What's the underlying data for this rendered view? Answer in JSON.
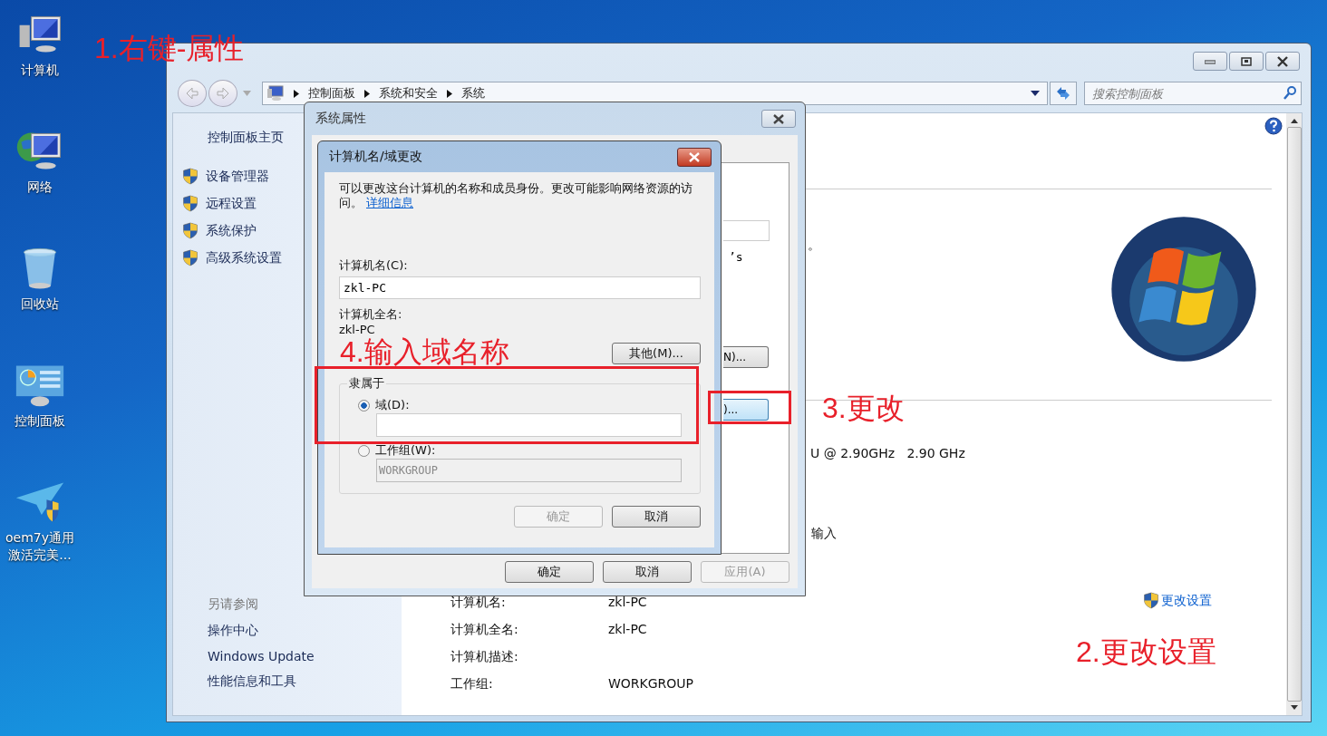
{
  "desktop_icons": [
    {
      "kind": "computer",
      "label": "计算机"
    },
    {
      "kind": "network",
      "label": "网络"
    },
    {
      "kind": "recycle",
      "label": "回收站"
    },
    {
      "kind": "control_panel",
      "label": "控制面板"
    },
    {
      "kind": "shield_plane",
      "label": "oem7y通用激活完美..."
    }
  ],
  "explorer": {
    "breadcrumb": [
      "控制面板",
      "系统和安全",
      "系统"
    ],
    "search": {
      "placeholder": "搜索控制面板"
    },
    "sidebar": {
      "home": "控制面板主页",
      "tasks": [
        "设备管理器",
        "远程设置",
        "系统保护",
        "高级系统设置"
      ],
      "see_also_title": "另请参阅",
      "see_also": [
        "操作中心",
        "Windows Update",
        "性能信息和工具"
      ]
    },
    "content": {
      "fragment_period": "。",
      "fragment_cpu": "U @ 2.90GHz   2.90 GHz",
      "fragment_input": "输入",
      "info_rows": [
        {
          "label": "计算机名:",
          "value": "zkl-PC"
        },
        {
          "label": "计算机全名:",
          "value": "zkl-PC"
        },
        {
          "label": "计算机描述:"
        },
        {
          "label": "工作组:",
          "value": "WORKGROUP"
        }
      ],
      "change_settings": "更改设置"
    }
  },
  "system_properties": {
    "title": "系统属性",
    "fragment_text": "’s",
    "partial_buttons": [
      {
        "label": "N)...",
        "focused": false
      },
      {
        "label": ")...",
        "focused": true
      }
    ],
    "buttons": [
      {
        "label": "确定",
        "disabled": false
      },
      {
        "label": "取消",
        "disabled": false
      },
      {
        "label": "应用(A)",
        "disabled": true
      }
    ]
  },
  "name_dialog": {
    "title": "计算机名/域更改",
    "intro": "可以更改这台计算机的名称和成员身份。更改可能影响网络资源的访问。",
    "link": "详细信息",
    "name_label": "计算机名(C):",
    "name_value": "zkl-PC",
    "full_name_label": "计算机全名:",
    "full_name": "zkl-PC",
    "more_button": "其他(M)...",
    "member_of": "隶属于",
    "options": [
      {
        "label": "域(D):",
        "selected": true
      },
      {
        "label": "工作组(W):",
        "selected": false,
        "value": "WORKGROUP"
      }
    ],
    "buttons": [
      {
        "label": "确定",
        "disabled": true
      },
      {
        "label": "取消",
        "disabled": false
      }
    ]
  },
  "annotations": [
    {
      "kind": "step1",
      "text": "1.右键-属性"
    },
    {
      "kind": "step4",
      "text": "4.输入域名称"
    },
    {
      "kind": "step3",
      "text": "3.更改"
    },
    {
      "kind": "step2",
      "text": "2.更改设置"
    }
  ]
}
